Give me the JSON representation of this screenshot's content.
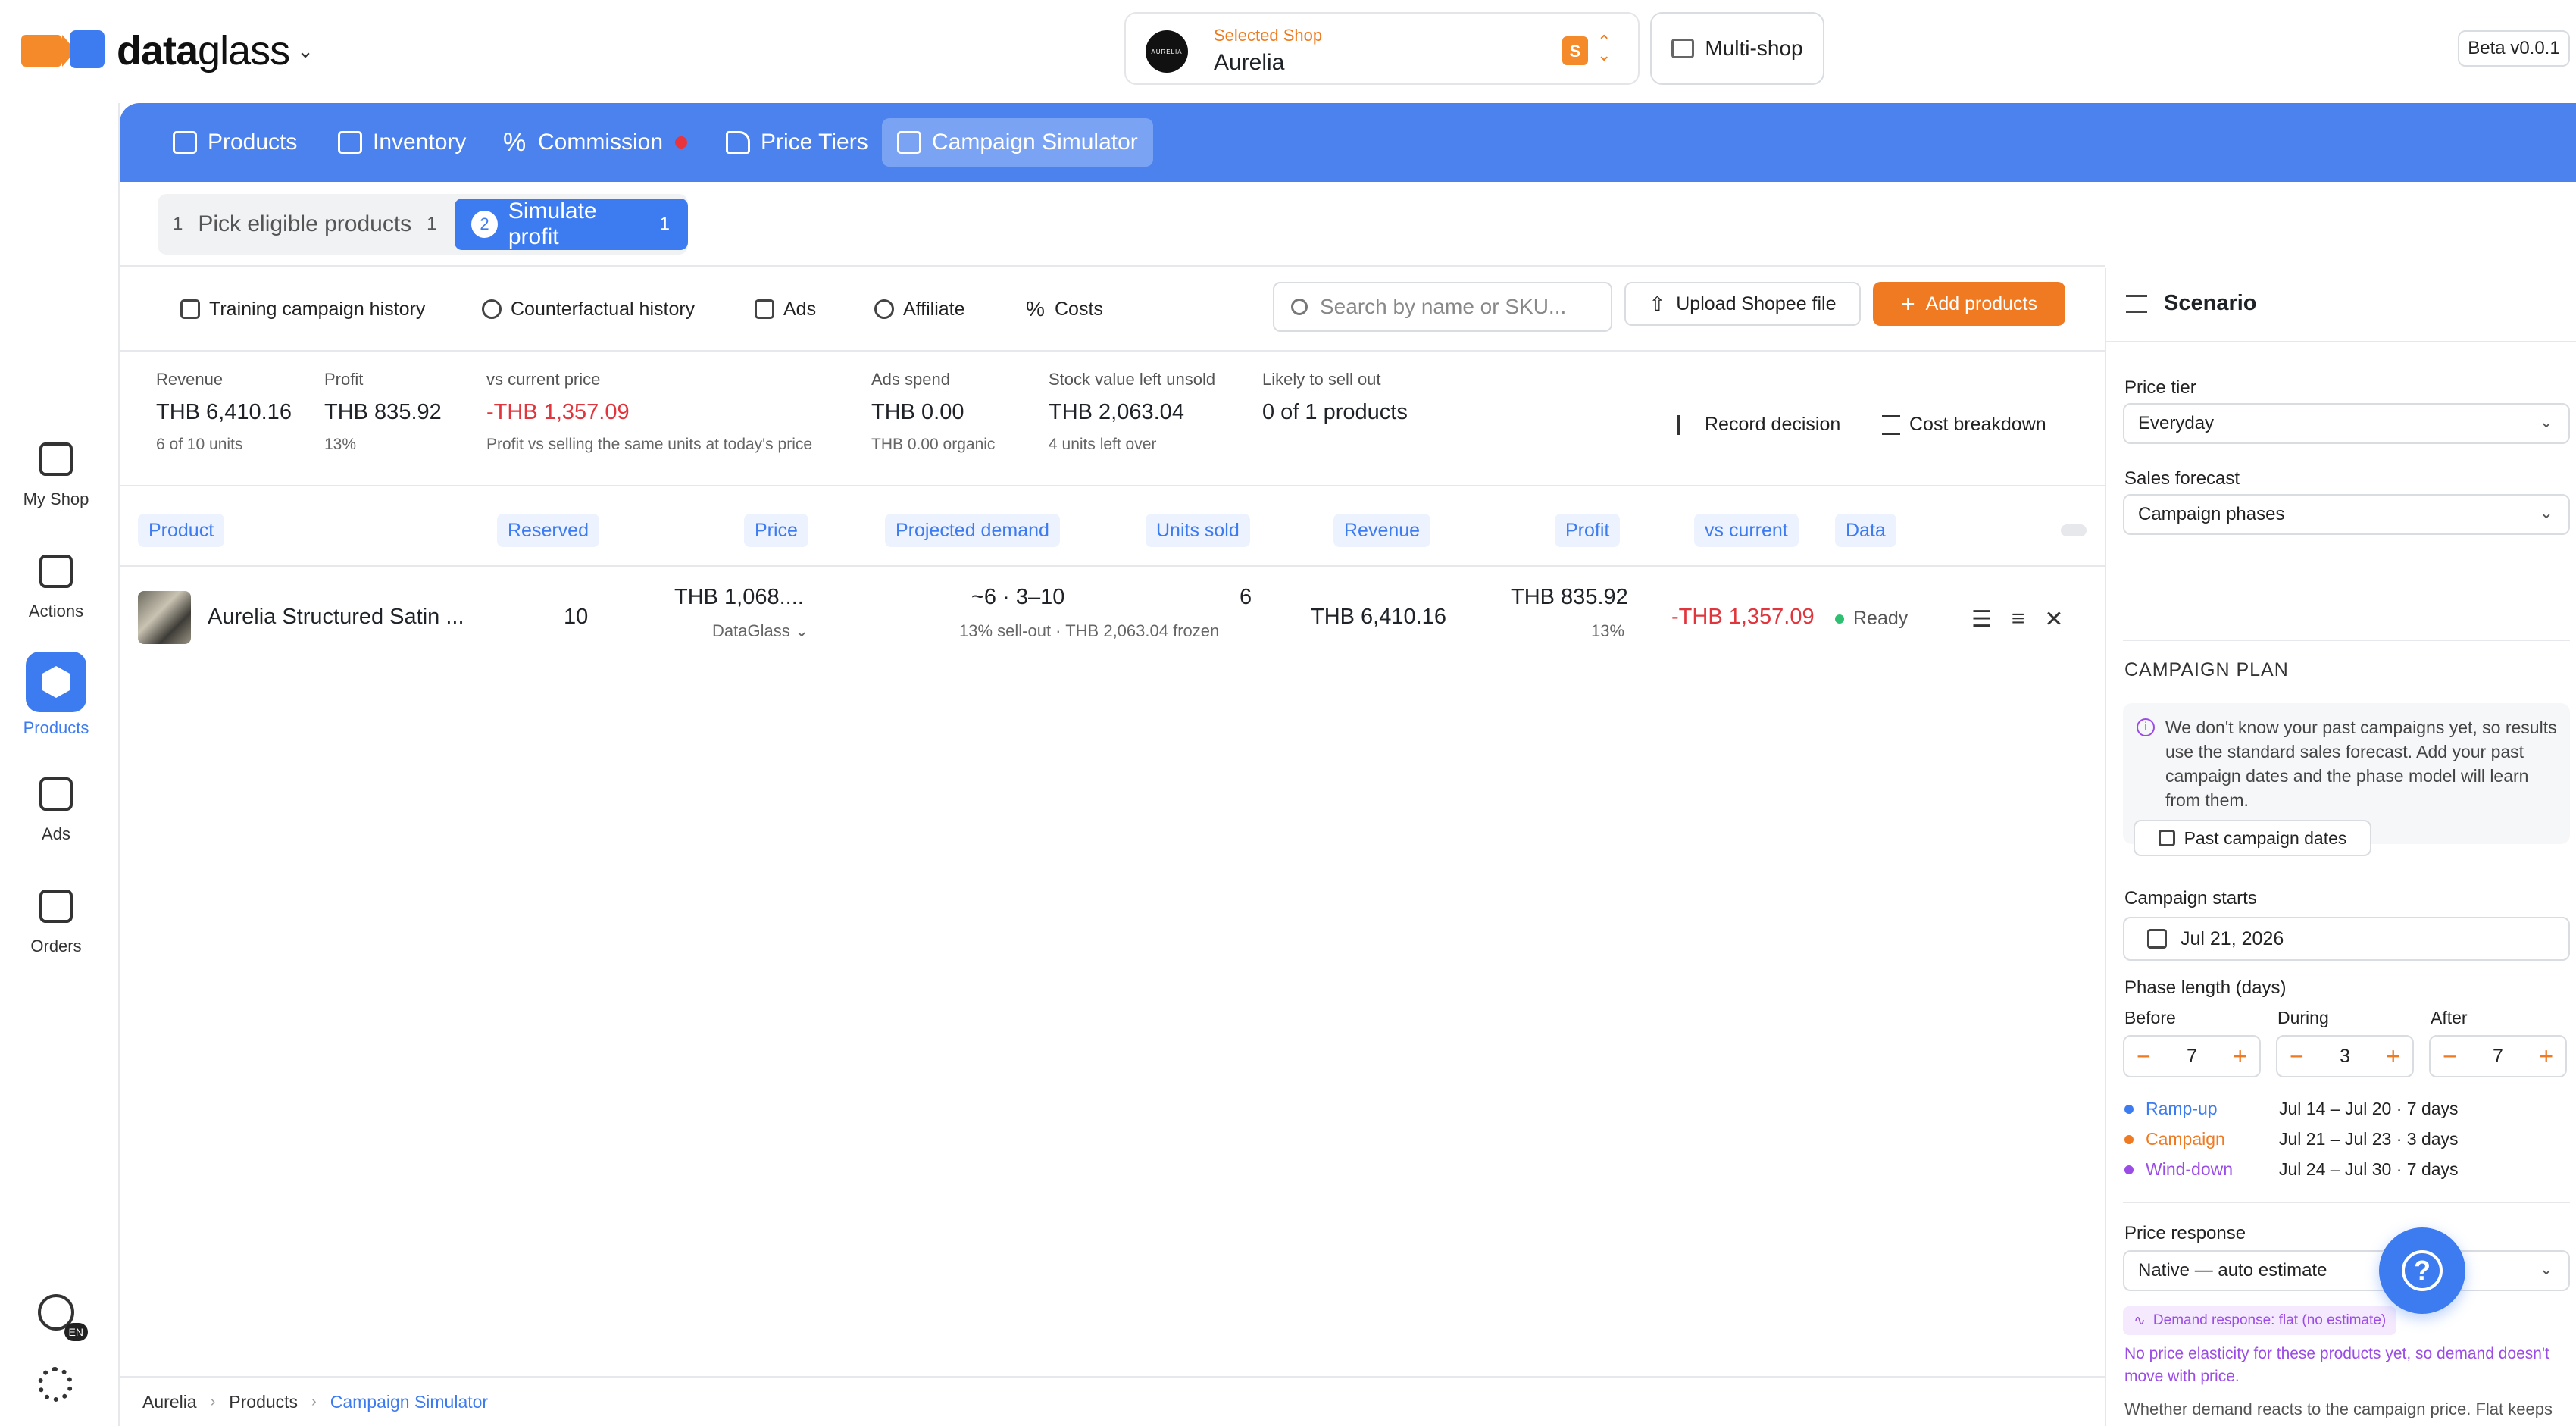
{
  "brand": {
    "name_bold": "data",
    "name_light": "glass"
  },
  "shop": {
    "label": "Selected Shop",
    "name": "Aurelia",
    "avatar_text": "AURELIA"
  },
  "multishop_label": "Multi-shop",
  "version": "Beta v0.0.1",
  "rail": [
    {
      "label": "My Shop",
      "icon": "shop-icon"
    },
    {
      "label": "Actions",
      "icon": "actions-icon"
    },
    {
      "label": "Products",
      "icon": "box-icon"
    },
    {
      "label": "Ads",
      "icon": "ads-icon"
    },
    {
      "label": "Orders",
      "icon": "orders-icon"
    }
  ],
  "language_badge": "EN",
  "nav": {
    "products": "Products",
    "inventory": "Inventory",
    "commission": "Commission",
    "price_tiers": "Price Tiers",
    "campaign_simulator": "Campaign Simulator"
  },
  "steps": {
    "step1_num": "1",
    "step1_label": "Pick eligible products",
    "step1_count": "1",
    "step2_num": "2",
    "step2_label": "Simulate profit",
    "step2_count": "1"
  },
  "toolbar": {
    "training": "Training campaign history",
    "counterfactual": "Counterfactual history",
    "ads": "Ads",
    "affiliate": "Affiliate",
    "costs": "Costs",
    "search_placeholder": "Search by name or SKU...",
    "upload": "Upload Shopee file",
    "add": "Add products"
  },
  "summary": {
    "revenue": {
      "label": "Revenue",
      "value": "THB 6,410.16",
      "sub": "6 of 10 units"
    },
    "profit": {
      "label": "Profit",
      "value": "THB 835.92",
      "sub": "13%"
    },
    "vs_current": {
      "label": "vs current price",
      "value": "-THB 1,357.09",
      "sub": "Profit vs selling the same units at today's price"
    },
    "ads_spend": {
      "label": "Ads spend",
      "value": "THB 0.00",
      "sub": "THB 0.00 organic"
    },
    "stock_value": {
      "label": "Stock value left unsold",
      "value": "THB 2,063.04",
      "sub": "4 units left over"
    },
    "sell_out": {
      "label": "Likely to sell out",
      "value": "0 of 1 products"
    },
    "record_decision": "Record decision",
    "cost_breakdown": "Cost breakdown"
  },
  "table": {
    "headers": [
      "Product",
      "Reserved",
      "Price",
      "Projected demand",
      "Units sold",
      "Revenue",
      "Profit",
      "vs current",
      "Data"
    ],
    "row": {
      "product": "Aurelia Structured Satin ...",
      "reserved": "10",
      "price": "THB 1,068....",
      "price_source": "DataGlass",
      "demand": "~6 · 3–10",
      "units_sold": "6",
      "units_sub": "13% sell-out · THB 2,063.04 frozen",
      "revenue": "THB 6,410.16",
      "profit": "THB 835.92",
      "profit_pct": "13%",
      "vs_current": "-THB 1,357.09",
      "data": "Ready"
    }
  },
  "panel": {
    "title": "Scenario",
    "price_tier_label": "Price tier",
    "price_tier_value": "Everyday",
    "sales_forecast_label": "Sales forecast",
    "sales_forecast_value": "Campaign phases",
    "campaign_plan": "CAMPAIGN PLAN",
    "info": "We don't know your past campaigns yet, so results use the standard sales forecast. Add your past campaign dates and the phase model will learn from them.",
    "past_dates_btn": "Past campaign dates",
    "campaign_starts_label": "Campaign starts",
    "campaign_starts_value": "Jul 21, 2026",
    "phase_length_label": "Phase length (days)",
    "before_label": "Before",
    "before_value": "7",
    "during_label": "During",
    "during_value": "3",
    "after_label": "After",
    "after_value": "7",
    "phases": [
      {
        "name": "Ramp-up",
        "range": "Jul 14 – Jul 20 · 7 days",
        "color": "#3d7bf1"
      },
      {
        "name": "Campaign",
        "range": "Jul 21 – Jul 23 · 3 days",
        "color": "#f07a22"
      },
      {
        "name": "Wind-down",
        "range": "Jul 24 – Jul 30 · 7 days",
        "color": "#9b4ce6"
      }
    ],
    "price_response_label": "Price response",
    "price_response_value": "Native — auto estimate",
    "demand_tag": "Demand response: flat (no estimate)",
    "no_elasticity": "No price elasticity for these products yet, so demand doesn't move with price.",
    "explain": "Whether demand reacts to the campaign price. Flat keeps demand flat; Native uses your shop's estimated elasticity; Manual applies an elasticity you set."
  },
  "breadcrumb": [
    "Aurelia",
    "Products",
    "Campaign Simulator"
  ],
  "colors": {
    "accent": "#3d7bf1",
    "orange": "#f07a22",
    "negative": "#e0353c",
    "purple": "#9b4ce6"
  }
}
